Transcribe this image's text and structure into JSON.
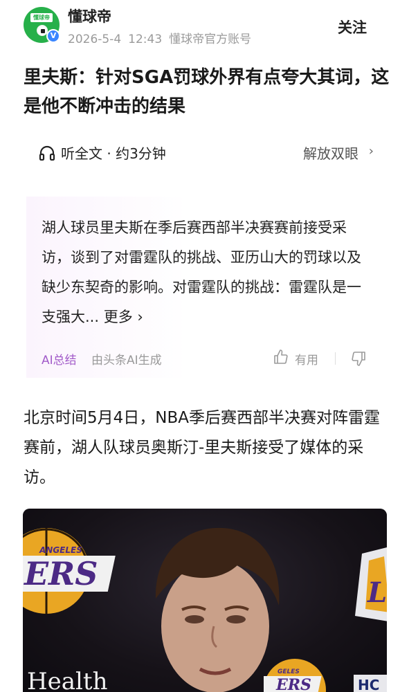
{
  "header": {
    "author_name": "懂球帝",
    "avatar_label": "懂球帝",
    "verified_badge": "V",
    "date": "2026-5-4",
    "time": "12:43",
    "account_type": "懂球帝官方账号",
    "follow_label": "关注"
  },
  "article": {
    "title": "里夫斯：针对SGA罚球外界有点夸大其词，这是他不断冲击的结果",
    "listen_label": "听全文 · 约3分钟",
    "eye_mode_label": "解放双眼",
    "body": "北京时间5月4日，NBA季后赛西部半决赛对阵雷霆赛前，湖人队球员奥斯汀-里夫斯接受了媒体的采访。"
  },
  "ai_summary": {
    "text": "湖人球员里夫斯在季后赛西部半决赛赛前接受采访，谈到了对雷霆队的挑战、亚历山大的罚球以及缺少东契奇的影响。对雷霆队的挑战：雷霆队是一支强大",
    "more_label": "... 更多",
    "badge": "AI总结",
    "source": "由头条AI生成",
    "useful_label": "有用"
  },
  "photo": {
    "health_text": "Health",
    "hc_text": "HC"
  },
  "colors": {
    "brand_green": "#27b04a",
    "ai_purple": "#a25bc9",
    "verified_blue": "#3a86ff"
  }
}
